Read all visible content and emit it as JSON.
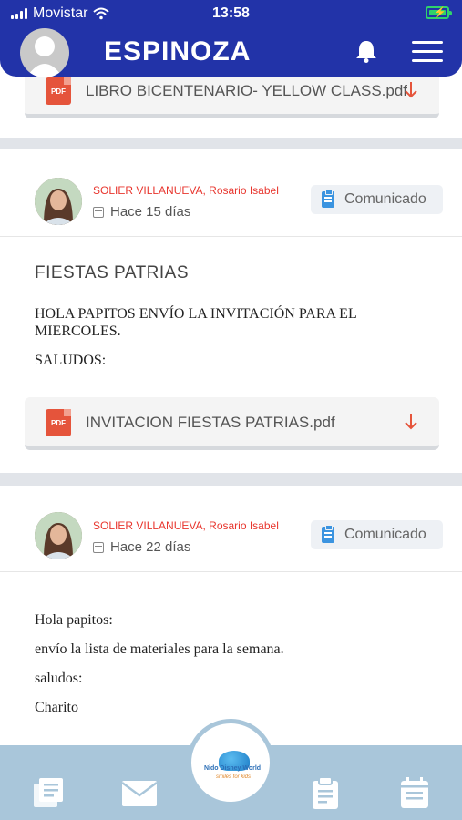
{
  "status_bar": {
    "carrier": "Movistar",
    "time": "13:58"
  },
  "header": {
    "title": "ESPINOZA"
  },
  "feed": {
    "top_attachment": {
      "filename": "LIBRO BICENTENARIO- YELLOW CLASS.pdf",
      "icon_label": "PDF"
    },
    "posts": [
      {
        "author": "SOLIER VILLANUEVA, Rosario Isabel",
        "time_ago": "Hace 15 días",
        "badge": "Comunicado",
        "title": "FIESTAS PATRIAS",
        "body": [
          "HOLA PAPITOS ENVÍO LA INVITACIÓN PARA EL MIERCOLES.",
          "SALUDOS:"
        ],
        "attachment": {
          "filename": "INVITACION FIESTAS PATRIAS.pdf",
          "icon_label": "PDF"
        }
      },
      {
        "author": "SOLIER VILLANUEVA, Rosario Isabel",
        "time_ago": "Hace 22 días",
        "badge": "Comunicado",
        "body": [
          "Hola papitos:",
          "envío la lista de materiales para la semana.",
          "saludos:",
          "Charito"
        ]
      }
    ]
  },
  "bottom_nav": {
    "logo_text": "Nido Disney World",
    "logo_subtext": "smiles for kids"
  },
  "colors": {
    "header": "#2233a8",
    "author": "#e8362e",
    "bottom_bar": "#a9c6da",
    "pdf": "#e5543b",
    "badge_icon": "#3b94e0"
  }
}
